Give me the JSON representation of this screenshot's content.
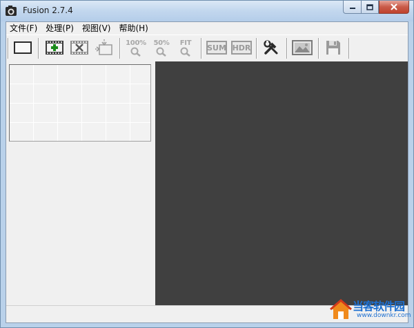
{
  "window": {
    "title": "Fusion 2.7.4"
  },
  "menu": [
    {
      "label": "文件(F)"
    },
    {
      "label": "处理(P)"
    },
    {
      "label": "视图(V)"
    },
    {
      "label": "帮助(H)"
    }
  ],
  "toolbar": {
    "zoom_100": "100%",
    "zoom_50": "50%",
    "zoom_fit": "FIT",
    "sum": "SUM",
    "hdr": "HDR"
  },
  "watermark": {
    "text": "当客软件园",
    "url": "www.downkr.com"
  },
  "colors": {
    "viewer_bg": "#404040",
    "title_gradient": "#c2d7ee",
    "close_red": "#c95a48",
    "add_green": "#1a8a1a"
  }
}
